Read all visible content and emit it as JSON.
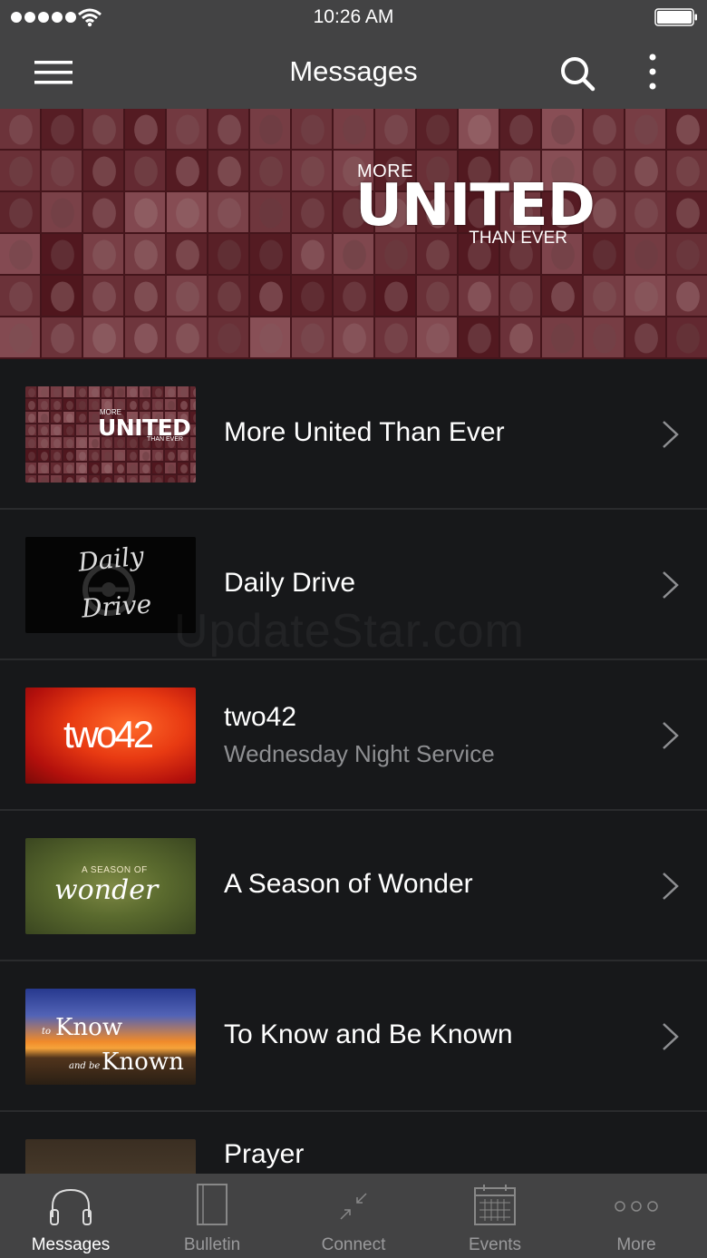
{
  "status_bar": {
    "time": "10:26 AM",
    "icons": [
      "signal-dots",
      "wifi-icon",
      "battery-icon"
    ]
  },
  "nav": {
    "title": "Messages",
    "icons": [
      "menu-icon",
      "search-icon",
      "kebab-icon"
    ]
  },
  "hero": {
    "logo_top": "MORE",
    "logo_main": "UNITED",
    "logo_bottom": "THAN EVER"
  },
  "list": {
    "items": [
      {
        "title": "More United Than Ever",
        "subtitle": "",
        "thumb_lines": [
          "MORE",
          "UNITED",
          "THAN EVER"
        ]
      },
      {
        "title": "Daily Drive",
        "subtitle": "",
        "thumb_lines": [
          "Daily",
          "Drive"
        ]
      },
      {
        "title": "two42",
        "subtitle": "Wednesday Night Service",
        "thumb_lines": [
          "two42"
        ]
      },
      {
        "title": "A Season of Wonder",
        "subtitle": "",
        "thumb_lines": [
          "A SEASON OF",
          "wonder"
        ]
      },
      {
        "title": "To Know and Be Known",
        "subtitle": "",
        "thumb_lines": [
          "to",
          "Know",
          "and be",
          "Known"
        ]
      },
      {
        "title": "Prayer",
        "subtitle": "",
        "thumb_lines": []
      }
    ]
  },
  "watermark": "UpdateStar.com",
  "tab_bar": {
    "tabs": [
      {
        "label": "Messages",
        "icon": "headphones-icon",
        "active": true
      },
      {
        "label": "Bulletin",
        "icon": "bulletin-icon",
        "active": false
      },
      {
        "label": "Connect",
        "icon": "connect-icon",
        "active": false
      },
      {
        "label": "Events",
        "icon": "calendar-icon",
        "active": false
      },
      {
        "label": "More",
        "icon": "more-dots-icon",
        "active": false
      }
    ]
  },
  "colors": {
    "bar_bg": "#434344",
    "list_bg": "#17181a",
    "divider": "#2a2b2d",
    "subtitle": "#8e8f92",
    "tab_inactive": "#9a9a9c"
  }
}
